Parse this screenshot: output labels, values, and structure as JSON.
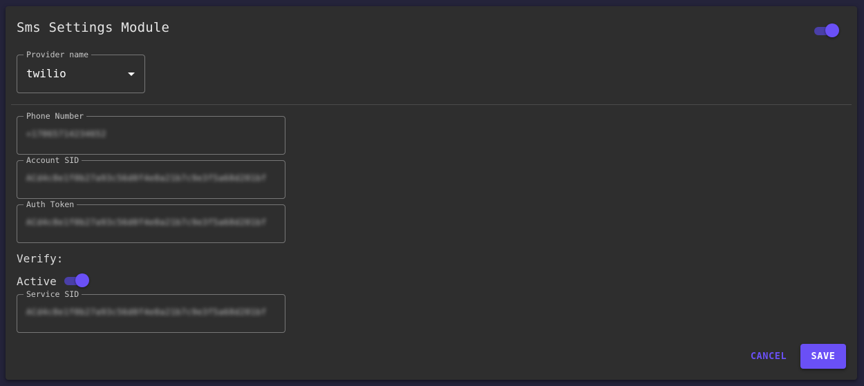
{
  "module": {
    "title": "Sms Settings Module",
    "enabled": true
  },
  "provider": {
    "label": "Provider name",
    "value": "twilio"
  },
  "fields": {
    "phone_number": {
      "label": "Phone Number",
      "value": "+17065714234652"
    },
    "account_sid": {
      "label": "Account SID",
      "value": "ACd4c8e1f0b27a93c56d0f4e8a21b7c9e3f5a68d201bf"
    },
    "auth_token": {
      "label": "Auth Token",
      "value": "ACd4c8e1f0b27a93c56d0f4e8a21b7c9e3f5a68d201bf"
    }
  },
  "verify": {
    "heading": "Verify:",
    "active_label": "Active",
    "active": true,
    "service_sid": {
      "label": "Service SID",
      "value": "ACd4c8e1f0b27a93c56d0f4e8a21b7c9e3f5a68d201bf"
    }
  },
  "actions": {
    "cancel_label": "CANCEL",
    "save_label": "SAVE"
  },
  "colors": {
    "accent": "#6a50f6",
    "background": "#2e2e2e",
    "page": "#24233a"
  }
}
